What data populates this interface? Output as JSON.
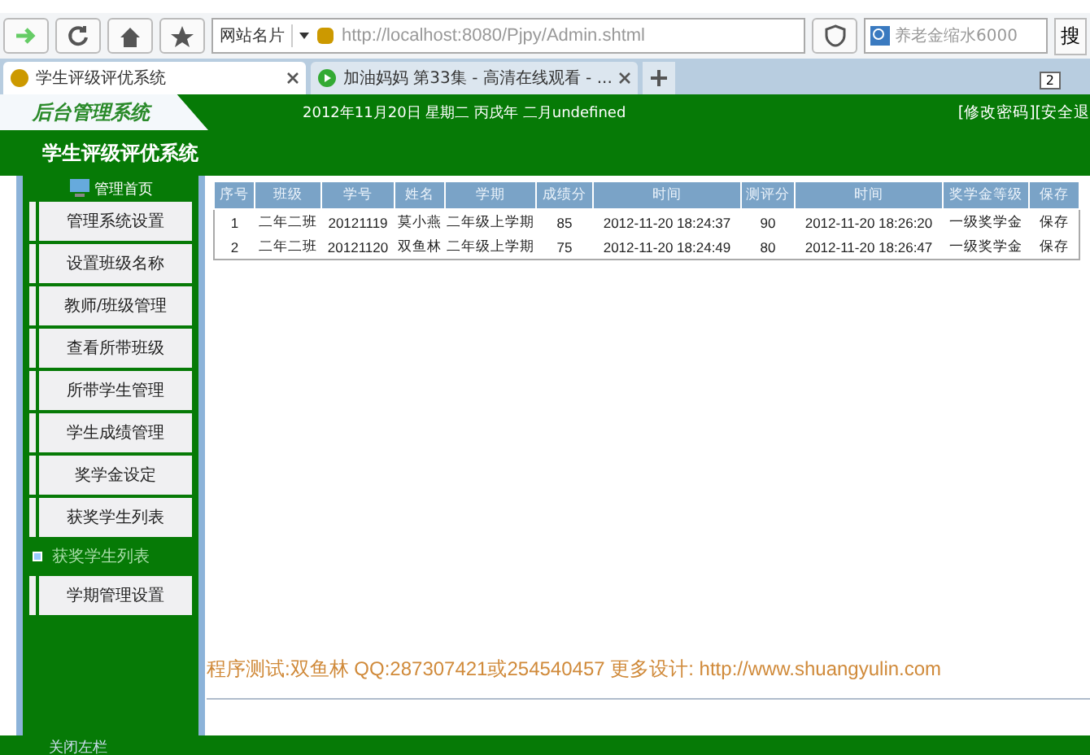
{
  "browser": {
    "address_menu": "网站名片",
    "url": "http://localhost:8080/Pjpy/Admin.shtml",
    "search_value": "养老金缩水6000",
    "search_button": "搜",
    "tabs": [
      {
        "label": "学生评级评优系统",
        "selected": true
      },
      {
        "label": "加油妈妈 第33集 - 高清在线观看 - ...",
        "selected": false
      }
    ],
    "tab_count": "2"
  },
  "header": {
    "logo": "后台管理系统",
    "date": "2012年11月20日 星期二 丙戌年 二月undefined",
    "links": [
      "[修改密码]",
      "[安全退"
    ],
    "title": "学生评级评优系统"
  },
  "sidebar": {
    "home": "管理首页",
    "items": [
      {
        "label": "管理系统设置",
        "kind": "button"
      },
      {
        "label": "设置班级名称",
        "kind": "button"
      },
      {
        "label": "教师/班级管理",
        "kind": "button"
      },
      {
        "label": "查看所带班级",
        "kind": "button"
      },
      {
        "label": "所带学生管理",
        "kind": "button"
      },
      {
        "label": "学生成绩管理",
        "kind": "button"
      },
      {
        "label": "奖学金设定",
        "kind": "button"
      },
      {
        "label": "获奖学生列表",
        "kind": "button"
      },
      {
        "label": "获奖学生列表",
        "kind": "bullet"
      },
      {
        "label": "学期管理设置",
        "kind": "button"
      }
    ],
    "toggle": "关闭左栏"
  },
  "table": {
    "columns": [
      "序号",
      "班级",
      "学号",
      "姓名",
      "学期",
      "成绩分",
      "时间",
      "测评分",
      "时间",
      "奖学金等级",
      "保存"
    ],
    "rows": [
      [
        "1",
        "二年二班",
        "20121119",
        "莫小燕",
        "二年级上学期",
        "85",
        "2012-11-20 18:24:37",
        "90",
        "2012-11-20 18:26:20",
        "一级奖学金",
        "保存"
      ],
      [
        "2",
        "二年二班",
        "20121120",
        "双鱼林",
        "二年级上学期",
        "75",
        "2012-11-20 18:24:49",
        "80",
        "2012-11-20 18:26:47",
        "一级奖学金",
        "保存"
      ]
    ]
  },
  "footer": "程序测试:双鱼林 QQ:287307421或254540457 更多设计: http://www.shuangyulin.com"
}
